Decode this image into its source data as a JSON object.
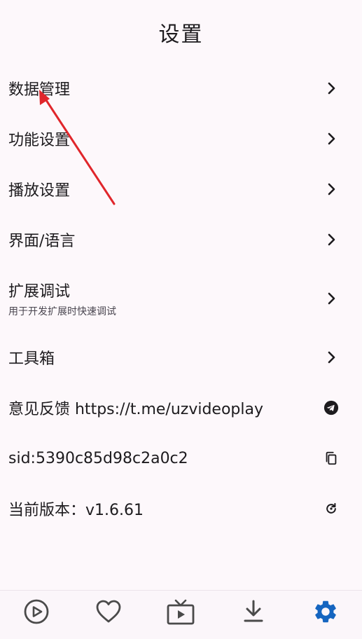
{
  "app_bar": {
    "title": "设置"
  },
  "settings": [
    {
      "title": "数据管理",
      "trailing_icon": "chevron-right-icon"
    },
    {
      "title": "功能设置",
      "trailing_icon": "chevron-right-icon"
    },
    {
      "title": "播放设置",
      "trailing_icon": "chevron-right-icon"
    },
    {
      "title": "界面/语言",
      "trailing_icon": "chevron-right-icon"
    },
    {
      "title": "扩展调试",
      "subtitle": "用于开发扩展时快速调试",
      "trailing_icon": "chevron-right-icon"
    },
    {
      "title": "工具箱",
      "trailing_icon": "chevron-right-icon"
    },
    {
      "title": "意见反馈 https://t.me/uzvideoplay",
      "trailing_icon": "telegram-icon"
    },
    {
      "title": "sid:5390c85d98c2a0c2",
      "trailing_icon": "copy-icon"
    },
    {
      "title": "当前版本：v1.6.61",
      "trailing_icon": "refresh-icon"
    }
  ],
  "annotation": {
    "icon": "red-arrow-annotation",
    "color": "#e0262b"
  },
  "bottom_nav": {
    "items": [
      {
        "icon": "play-circle-icon",
        "active": false
      },
      {
        "icon": "heart-icon",
        "active": false
      },
      {
        "icon": "tv-icon",
        "active": false
      },
      {
        "icon": "download-icon",
        "active": false
      },
      {
        "icon": "gear-icon",
        "active": true
      }
    ],
    "active_color": "#1565c0",
    "inactive_color": "#4a4a4a"
  }
}
